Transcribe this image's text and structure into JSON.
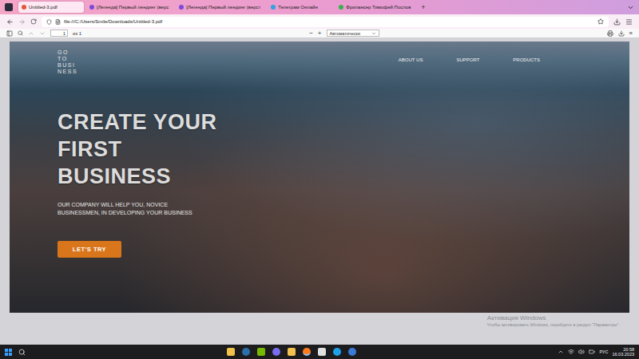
{
  "browser": {
    "tabs": [
      {
        "label": "Untitled-3.pdf",
        "selected": true
      },
      {
        "label": "[Легенда] Первый лендинг (верс",
        "selected": false
      },
      {
        "label": "[Легенда] Первый лендинг (верст",
        "selected": false
      },
      {
        "label": "Телеграм Онлайн",
        "selected": false
      },
      {
        "label": "Фрилансер Тимофей Послов",
        "selected": false
      }
    ],
    "new_tab": "+",
    "url": "file:///C:/Users/Smile/Downloads/Untitled-3.pdf"
  },
  "pdf_toolbar": {
    "page": "1",
    "page_count": "из 1",
    "zoom_out": "−",
    "zoom_in": "+",
    "zoom": "Автоматически",
    "more": "»"
  },
  "page": {
    "logo": [
      "GO",
      "TO",
      "BUSI",
      "NESS"
    ],
    "nav": [
      "ABOUT US",
      "SUPPORT",
      "PRODUCTS"
    ],
    "heading": [
      "CREATE YOUR",
      "FIRST",
      "BUSINESS"
    ],
    "subtitle": [
      "OUR COMPANY WILL HELP YOU, NOVICE",
      "BUSINESSMEN, IN DEVELOPING YOUR BUSINESS"
    ],
    "button": "LET'S TRY"
  },
  "watermark": {
    "title": "Активация Windows",
    "text": "Чтобы активировать Windows, перейдите в раздел \"Параметры\"."
  },
  "taskbar": {
    "language": "РУС",
    "time": "20:58",
    "date": "16.03.2023"
  }
}
